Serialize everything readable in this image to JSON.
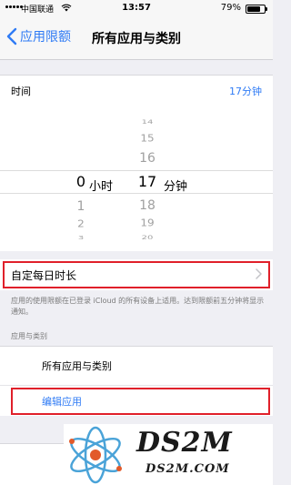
{
  "status_bar": {
    "carrier": "中国联通",
    "time": "13:57",
    "battery": "79%"
  },
  "nav": {
    "back_label": "应用限额",
    "title": "所有应用与类别"
  },
  "time_row": {
    "label": "时间",
    "value": "17分钟"
  },
  "picker": {
    "hour_unit": "小时",
    "minute_unit": "分钟",
    "hour_below": [
      "1",
      "2",
      "3"
    ],
    "hour_selected": "0",
    "minutes_above": [
      "14",
      "15",
      "16"
    ],
    "minute_selected": "17",
    "minutes_below": [
      "18",
      "19",
      "20"
    ]
  },
  "custom_daily": {
    "label": "自定每日时长"
  },
  "footnote": "应用的使用限额在已登录 iCloud 的所有设备上适用。达到限额前五分钟将显示通知。",
  "section_header": "应用与类别",
  "apps": {
    "all_label": "所有应用与类别",
    "edit_label": "编辑应用"
  },
  "watermark": {
    "title": "DS2M",
    "subtitle": "DS2M.COM"
  },
  "colors": {
    "accent": "#2f7bf5",
    "highlight": "#e0202a"
  }
}
